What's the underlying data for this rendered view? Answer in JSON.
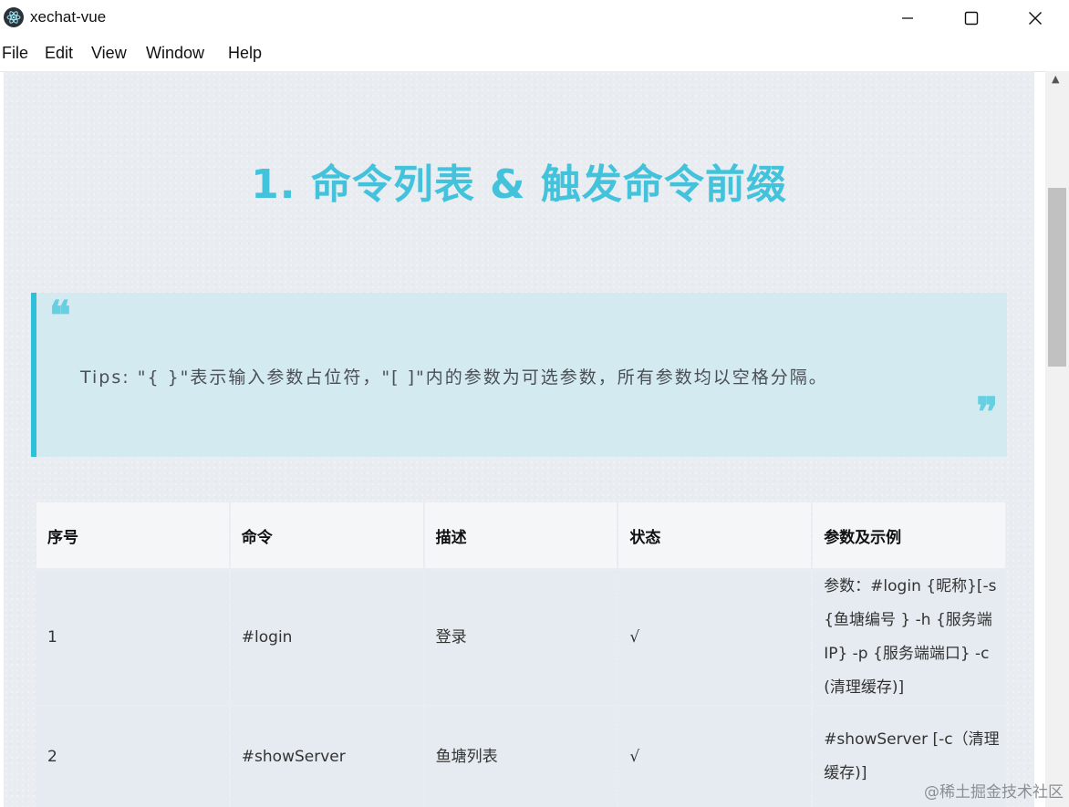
{
  "window": {
    "title": "xechat-vue",
    "app_icon": "electron-icon"
  },
  "menu": [
    "File",
    "Edit",
    "View",
    "Window",
    "Help"
  ],
  "page": {
    "heading": "1. 命令列表 & 触发命令前缀",
    "tip": {
      "open_mark": "❝",
      "close_mark": "❞",
      "text": "Tips: \"{ }\"表示输入参数占位符，\"[ ]\"内的参数为可选参数，所有参数均以空格分隔。"
    }
  },
  "table": {
    "headers": [
      "序号",
      "命令",
      "描述",
      "状态",
      "参数及示例"
    ],
    "rows": [
      {
        "index": "1",
        "command": "#login",
        "description": "登录",
        "status": "√",
        "params": "参数：#login {昵称}[-s {鱼塘编号 } -h {服务端IP} -p {服务端端口} -c (清理缓存)]"
      },
      {
        "index": "2",
        "command": "#showServer",
        "description": "鱼塘列表",
        "status": "√",
        "params": "#showServer [-c（清理缓存)]"
      }
    ]
  },
  "watermark": "@稀土掘金技术社区",
  "colors": {
    "heading": "#42c3db",
    "quote_bg": "#d3eaf0",
    "quote_border": "#2ec0d8",
    "page_bg": "#e9edf1"
  }
}
